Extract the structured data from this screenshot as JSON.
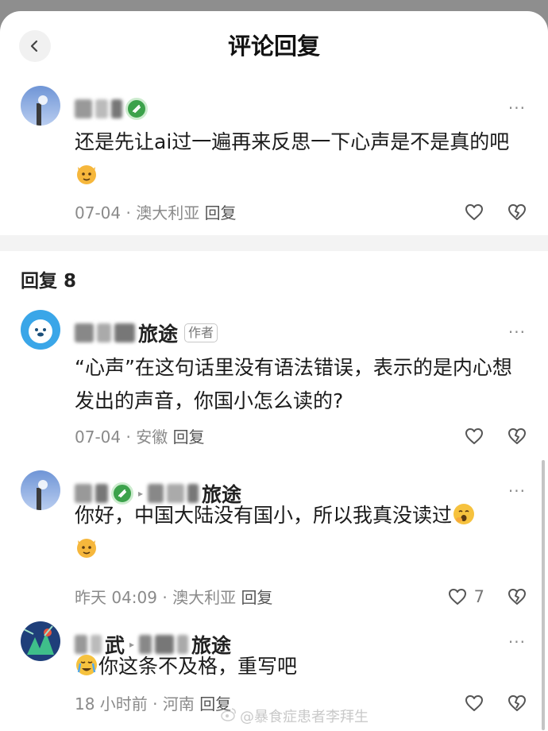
{
  "header": {
    "title": "评论回复"
  },
  "main_comment": {
    "text": "还是先让ai过一遍再来反思一下心声是不是真的吧",
    "date": "07-04",
    "location": "澳大利亚",
    "reply_label": "回复"
  },
  "replies_header": {
    "label": "回复 8"
  },
  "replies": [
    {
      "name_suffix": "旅途",
      "author_tag": "作者",
      "text": "“心声”在这句话里没有语法错误，表示的是内心想发出的声音，你国小怎么读的?",
      "date": "07-04",
      "location": "安徽",
      "reply_label": "回复"
    },
    {
      "target_suffix": "旅途",
      "text": "你好，中国大陆没有国小，所以我真没读过",
      "date": "昨天 04:09",
      "location": "澳大利亚",
      "reply_label": "回复",
      "like_count": "7"
    },
    {
      "name_suffix": "武",
      "target_suffix": "旅途",
      "text": "你这条不及格，重写吧",
      "date": "18 小时前",
      "location": "河南",
      "reply_label": "回复"
    }
  ],
  "watermark": "@暴食症患者李拜生",
  "meta_separator": "·",
  "more_glyph": "···",
  "colors": {
    "badge_green": "#3ca24b",
    "divider": "#f3f3f3",
    "muted": "#8a8a8a"
  }
}
